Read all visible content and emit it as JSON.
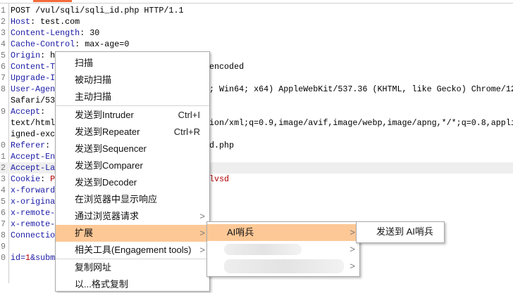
{
  "editor": {
    "lines": [
      {
        "n": "1",
        "k": "POST /vul/sqli/sqli_id.php HTTP/1.1",
        "v": "",
        "rt": ""
      },
      {
        "n": "2",
        "k": "Host",
        "v": ": test.com",
        "rt": ""
      },
      {
        "n": "3",
        "k": "Content-Length",
        "v": ": 30",
        "rt": ""
      },
      {
        "n": "4",
        "k": "Cache-Control",
        "v": ": max-age=0",
        "rt": ""
      },
      {
        "n": "5",
        "k": "Origin",
        "v": ": h",
        "rt": ""
      },
      {
        "n": "6",
        "k": "Content-T",
        "v": "",
        "rt": "encoded"
      },
      {
        "n": "7",
        "k": "Upgrade-I",
        "v": "",
        "rt": ""
      },
      {
        "n": "8",
        "k": "User-Agen",
        "v": "",
        "rt": "; Win64; x64) AppleWebKit/537.36 (KHTML, like Gecko) Chrome/12"
      },
      {
        "n": "",
        "k": "",
        "v": "Safari/53",
        "rt": ""
      },
      {
        "n": "9",
        "k": "Accept",
        "v": ":",
        "rt": ""
      },
      {
        "n": "",
        "k": "",
        "v": "text/html",
        "rt": "ion/xml;q=0.9,image/avif,image/webp,image/apng,*/*;q=0.8,appli"
      },
      {
        "n": "",
        "k": "",
        "v": "igned-exc",
        "rt": ""
      },
      {
        "n": "0",
        "k": "Referer",
        "v": ":",
        "rt": "d.php"
      },
      {
        "n": "1",
        "k": "Accept-En",
        "v": "",
        "rt": ""
      },
      {
        "n": "2",
        "k": "Accept-La",
        "v": "",
        "rt": ""
      },
      {
        "n": "3",
        "k": "Cookie",
        "v": ": ",
        "p": "P",
        "rt": "lvsd"
      },
      {
        "n": "4",
        "k": "x-forward",
        "v": "",
        "rt": ""
      },
      {
        "n": "5",
        "k": "x-origina",
        "v": "",
        "rt": ""
      },
      {
        "n": "6",
        "k": "x-remote-",
        "v": "",
        "rt": ""
      },
      {
        "n": "7",
        "k": "x-remote-",
        "v": "",
        "rt": ""
      },
      {
        "n": "8",
        "k": "Connectio",
        "v": "",
        "rt": ""
      },
      {
        "n": "9",
        "k": "",
        "v": "",
        "rt": ""
      },
      {
        "n": "0",
        "k": "id=",
        "v": "",
        "p": "1",
        "k2": "&subm",
        "rt": ""
      }
    ]
  },
  "menu": {
    "items": [
      "扫描",
      "被动扫描",
      "主动扫描",
      "发送到Intruder",
      "发送到Repeater",
      "发送到Sequencer",
      "发送到Comparer",
      "发送到Decoder",
      "在浏览器中显示响应",
      "通过浏览器请求",
      "扩展",
      "相关工具(Engagement tools)",
      "复制网址",
      "以...格式复制"
    ],
    "shortcuts": {
      "intruder": "Ctrl+I",
      "repeater": "Ctrl+R"
    },
    "arrow": ">"
  },
  "submenu": {
    "item": "AI哨兵"
  },
  "submenu2": {
    "item": "发送到 AI哨兵"
  }
}
